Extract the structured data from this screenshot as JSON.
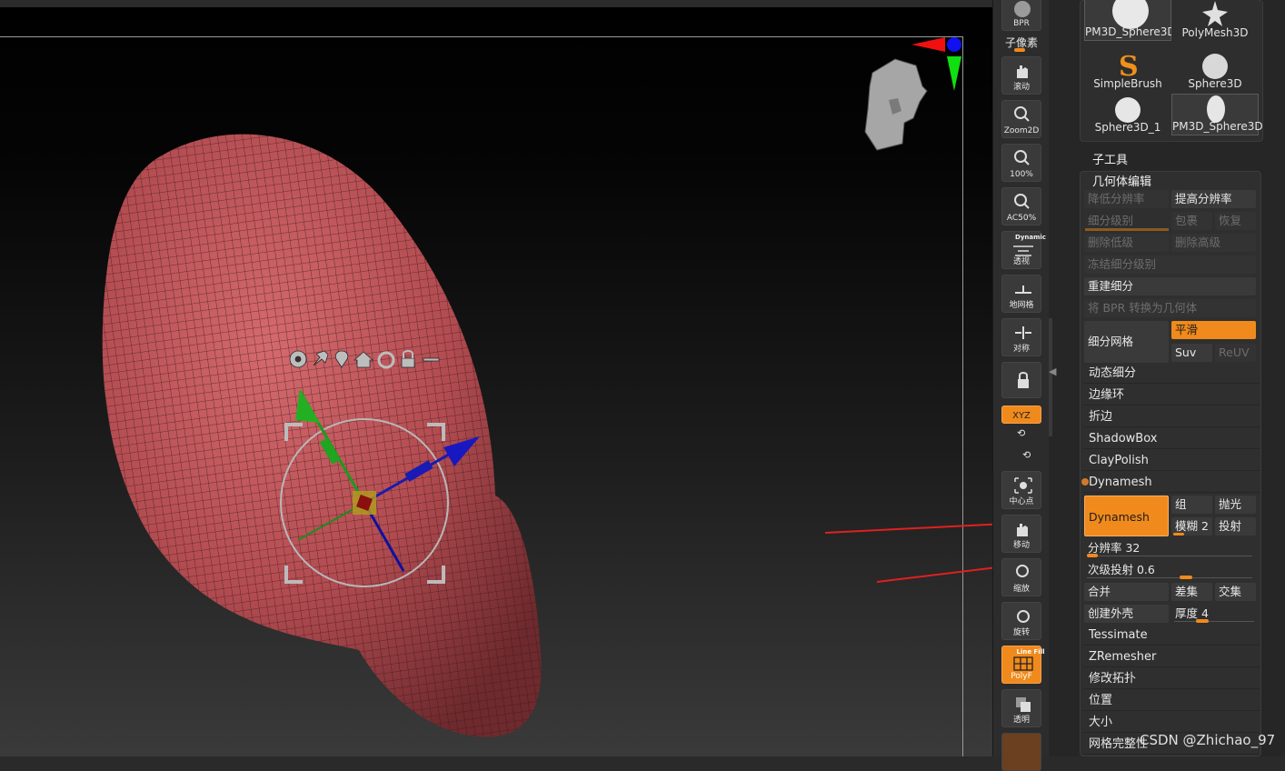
{
  "shelf": {
    "bpr_label": "BPR",
    "subpixel_label": "子像素",
    "buttons": {
      "scroll": "滚动",
      "zoom2d": "Zoom2D",
      "pct100": "100%",
      "ac50": "AC50%",
      "dynamic_top": "Dynamic",
      "persp": "透视",
      "floor": "地网格",
      "symmetry": "对称",
      "xyz": "XYZ",
      "center": "中心点",
      "move": "移动",
      "scale": "缩放",
      "rotate": "旋转",
      "linefill_top": "Line Fill",
      "polyf": "PolyF",
      "transp": "透明"
    }
  },
  "tools": [
    {
      "name": "PM3D_Sphere3D"
    },
    {
      "name": "PolyMesh3D"
    },
    {
      "name": "SimpleBrush"
    },
    {
      "name": "Sphere3D"
    },
    {
      "name": "Sphere3D_1"
    },
    {
      "name": "PM3D_Sphere3D"
    }
  ],
  "panel": {
    "subtool": "子工具",
    "geometry": "几何体编辑",
    "lower_res": "降低分辨率",
    "higher_res": "提高分辨率",
    "sdiv": "细分级别",
    "reconstruct": "包裹",
    "restore": "恢复",
    "del_lower": "删除低级",
    "del_higher": "删除高级",
    "freeze": "冻结细分级别",
    "rebuild": "重建细分",
    "bpr_to_geo": "将 BPR 转换为几何体",
    "divide": "细分网格",
    "smooth": "平滑",
    "suv": "Suv",
    "reuv": "ReUV",
    "dynamic_sub": "动态细分",
    "edge_loop": "边缘环",
    "crease": "折边",
    "shadowbox": "ShadowBox",
    "claypolish": "ClayPolish",
    "dynamesh_header": "Dynamesh",
    "dynamesh_btn": "Dynamesh",
    "group": "组",
    "polish": "抛光",
    "blur": "模糊 2",
    "project": "投射",
    "resolution": "分辨率 32",
    "subproject": "次级投射 0.6",
    "add": "合并",
    "sub": "差集",
    "and": "交集",
    "shell": "创建外壳",
    "thickness": "厚度 4",
    "tessimate": "Tessimate",
    "zremesher": "ZRemesher",
    "topology": "修改拓扑",
    "position": "位置",
    "size": "大小",
    "mesh_integrity": "网格完整性"
  },
  "watermark": "CSDN @Zhichao_97",
  "colors": {
    "accent": "#f08a1c",
    "mesh": "#c0555a",
    "annotation_arrow": "#e02020"
  }
}
